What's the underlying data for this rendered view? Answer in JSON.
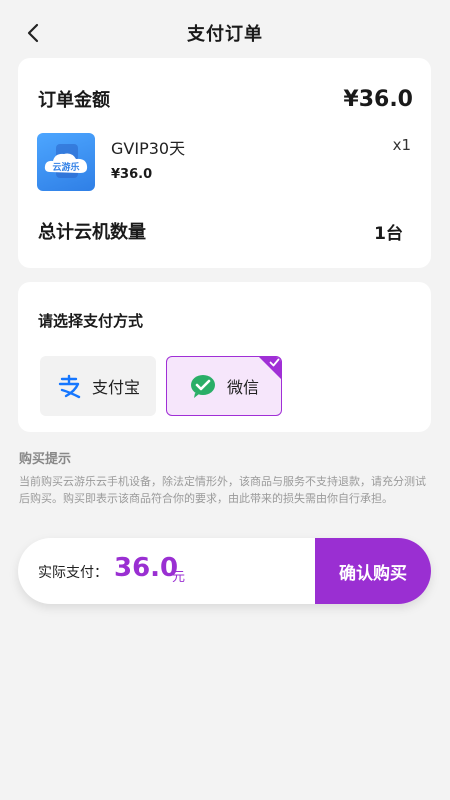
{
  "header": {
    "title": "支付订单"
  },
  "order": {
    "amount_label": "订单金额",
    "amount_value": "¥36.0",
    "product": {
      "icon_label": "云游乐",
      "name": "GVIP30天",
      "price": "¥36.0",
      "quantity": "x1"
    },
    "total_label": "总计云机数量",
    "total_value": "1台"
  },
  "payment": {
    "title": "请选择支付方式",
    "options": [
      {
        "label": "支付宝",
        "selected": false
      },
      {
        "label": "微信",
        "selected": true
      }
    ]
  },
  "tips": {
    "title": "购买提示",
    "text": "当前购买云游乐云手机设备，除法定情形外，该商品与服务不支持退款，请充分测试后购买。购买即表示该商品符合你的要求，由此带来的损失需由你自行承担。"
  },
  "bottom": {
    "pay_label": "实际支付：",
    "pay_amount": "36.0",
    "pay_unit": "元",
    "confirm_label": "确认购买"
  },
  "colors": {
    "accent": "#9a2fd2",
    "alipay": "#1677ff",
    "wechat": "#2aae67"
  }
}
